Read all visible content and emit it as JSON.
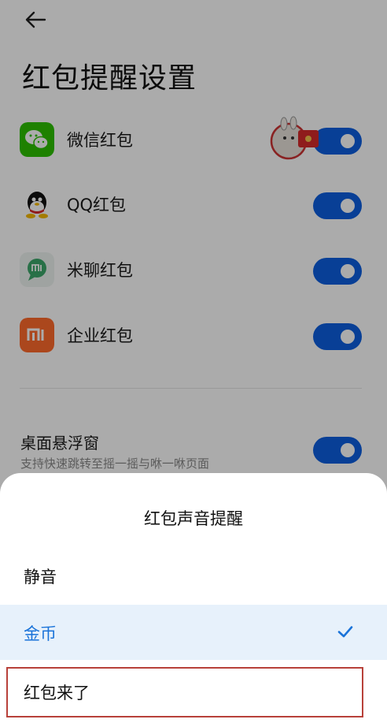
{
  "page": {
    "title": "红包提醒设置"
  },
  "apps": [
    {
      "name": "微信红包",
      "enabled": true,
      "icon": "wechat-icon"
    },
    {
      "name": "QQ红包",
      "enabled": true,
      "icon": "qq-icon"
    },
    {
      "name": "米聊红包",
      "enabled": true,
      "icon": "miliao-icon"
    },
    {
      "name": "企业红包",
      "enabled": true,
      "icon": "mi-enterprise-icon"
    }
  ],
  "floating_window": {
    "title": "桌面悬浮窗",
    "subtitle": "支持快速跳转至摇一摇与咻一咻页面",
    "enabled": true
  },
  "sheet": {
    "title": "红包声音提醒",
    "options": [
      {
        "label": "静音",
        "selected": false
      },
      {
        "label": "金币",
        "selected": true
      },
      {
        "label": "红包来了",
        "selected": false
      }
    ]
  },
  "colors": {
    "accent": "#0d5fe0",
    "selected_text": "#1a73d9",
    "selected_bg": "#e7f1fb",
    "highlight_border": "#b8413a"
  }
}
